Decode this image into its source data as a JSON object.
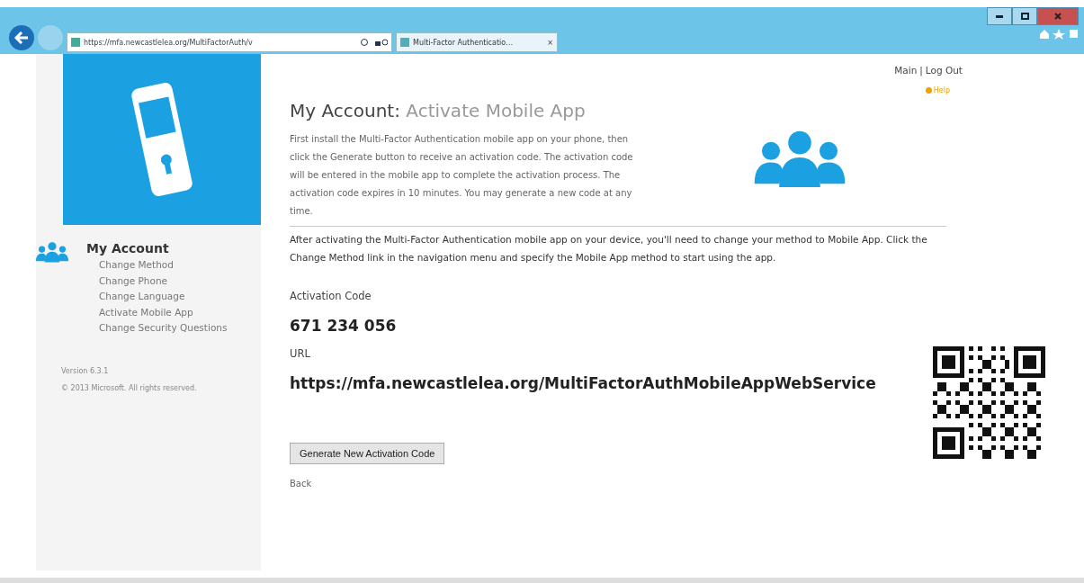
{
  "browser": {
    "address": "https://mfa.newcastlelea.org/MultiFactorAuth/v",
    "tab_title": "Multi-Factor Authenticatio…",
    "tab_close": "×"
  },
  "top_links": {
    "main": "Main",
    "separator": "|",
    "logout": "Log Out",
    "help": "Help"
  },
  "sidebar": {
    "heading": "My Account",
    "items": [
      {
        "label": "Change Method"
      },
      {
        "label": "Change Phone"
      },
      {
        "label": "Change Language"
      },
      {
        "label": "Activate Mobile App"
      },
      {
        "label": "Change Security Questions"
      }
    ],
    "version": "Version 6.3.1",
    "copyright": "© 2013 Microsoft. All rights reserved."
  },
  "main": {
    "title_prefix": "My Account:",
    "title": "Activate Mobile App",
    "intro": "First install the Multi-Factor Authentication mobile app on your phone, then click the Generate button to receive an activation code. The activation code will be entered in the mobile app to complete the activation process. The activation code expires in 10 minutes. You may generate a new code at any time.",
    "note": "After activating the Multi-Factor Authentication mobile app on your device, you'll need to change your method to Mobile App. Click the Change Method link in the navigation menu and specify the Mobile App method to start using the app.",
    "code_label": "Activation Code",
    "code": "671 234 056",
    "url_label": "URL",
    "url": "https://mfa.newcastlelea.org/MultiFactorAuthMobileAppWebService",
    "button": "Generate New Activation Code",
    "back": "Back"
  }
}
